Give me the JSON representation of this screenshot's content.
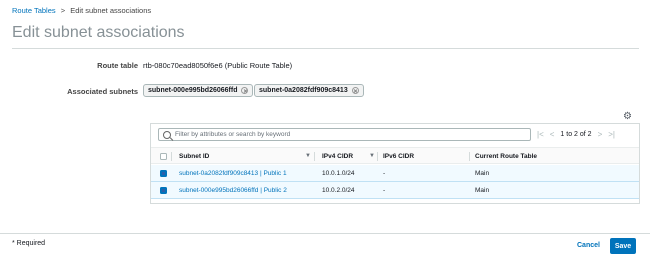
{
  "breadcrumb": {
    "link": "Route Tables",
    "separator": ">",
    "current": "Edit subnet associations"
  },
  "page_title": "Edit subnet associations",
  "route_table": {
    "label": "Route table",
    "value": "rtb-080c70ead8050f6e6 (Public Route Table)"
  },
  "associated_subnets": {
    "label": "Associated subnets",
    "tags": [
      "subnet-000e995bd26066ffd",
      "subnet-0a2082fdf909c8413"
    ]
  },
  "filter": {
    "placeholder": "Filter by attributes or search by keyword"
  },
  "pagination": {
    "first": "|<",
    "prev": "<",
    "text": "1 to 2 of 2",
    "next": ">",
    "last": ">|"
  },
  "table": {
    "columns": [
      "Subnet ID",
      "IPv4 CIDR",
      "IPv6 CIDR",
      "Current Route Table"
    ],
    "rows": [
      {
        "subnet_id": "subnet-0a2082fdf909c8413 | Public 1",
        "ipv4": "10.0.1.0/24",
        "ipv6": "-",
        "route_table": "Main",
        "selected": true
      },
      {
        "subnet_id": "subnet-000e995bd26066ffd | Public 2",
        "ipv4": "10.0.2.0/24",
        "ipv6": "-",
        "route_table": "Main",
        "selected": true
      }
    ]
  },
  "footer": {
    "required_note": "* Required",
    "cancel_label": "Cancel",
    "save_label": "Save"
  },
  "colors": {
    "accent": "#0073bb",
    "selected_row": "#f1faff"
  },
  "icons": {
    "settings": "gear-icon",
    "search": "search-icon",
    "remove_tag": "close-icon"
  }
}
